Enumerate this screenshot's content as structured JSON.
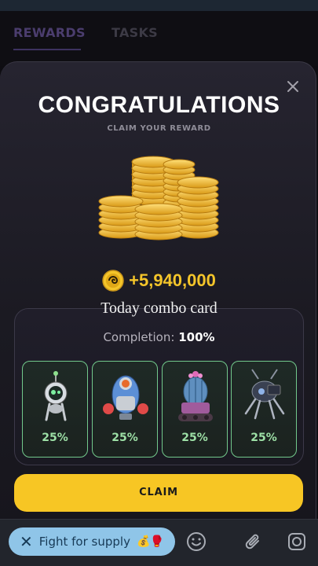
{
  "background": {
    "tabs": [
      {
        "label": "REWARDS"
      },
      {
        "label": "TASKS"
      }
    ]
  },
  "modal": {
    "title": "CONGRATULATIONS",
    "subtitle": "CLAIM YOUR REWARD",
    "amount": "+5,940,000",
    "combo_label": "Today combo card",
    "completion_label": "Completion:",
    "completion_value": "100%",
    "cards": [
      {
        "icon": "robot-drone-icon",
        "percent": "25%"
      },
      {
        "icon": "boxer-robot-icon",
        "percent": "25%"
      },
      {
        "icon": "cactus-tank-icon",
        "percent": "25%"
      },
      {
        "icon": "spider-drone-icon",
        "percent": "25%"
      }
    ],
    "claim_label": "CLAIM"
  },
  "bottom": {
    "chip_label": "Fight for supply",
    "chip_emoji": "💰🥊"
  },
  "colors": {
    "accent_yellow": "#f7c624",
    "card_border": "#72c98c",
    "percent_green": "#9de0a6",
    "chip_bg": "#8fc5e8"
  }
}
